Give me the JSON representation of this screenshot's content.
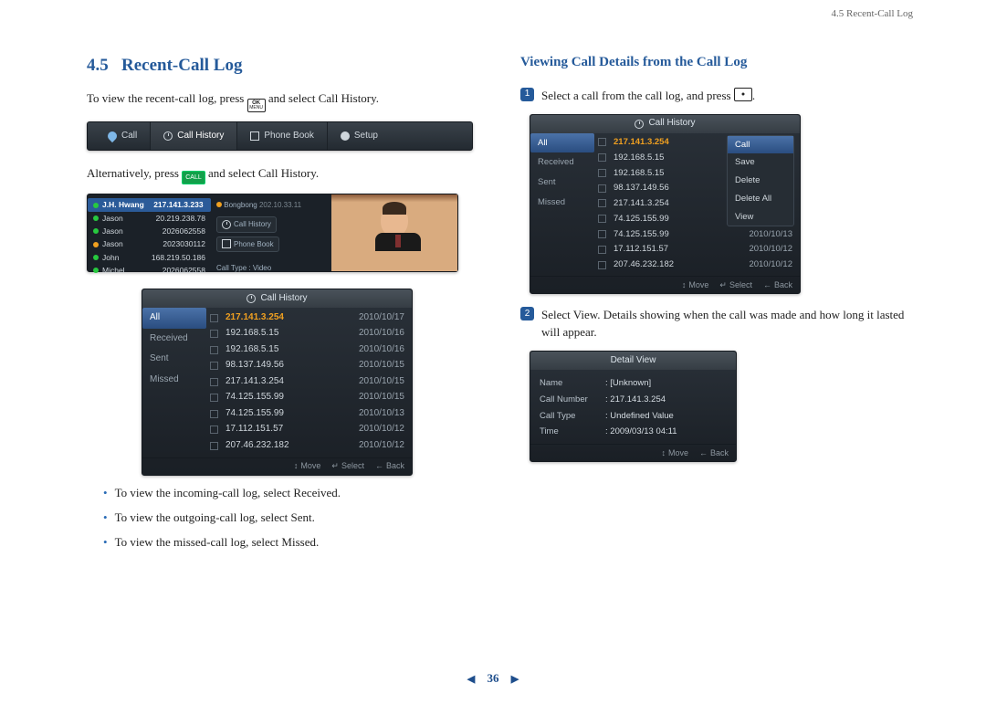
{
  "runhead": "4.5 Recent-Call Log",
  "section_no": "4.5",
  "section_title": "Recent-Call Log",
  "p1_a": "To view the recent-call log, press ",
  "p1_b": " and select Call History.",
  "kbd_ok_top": "OK",
  "kbd_ok_bot": "MENU",
  "p2_a": "Alternatively, press ",
  "p2_b": " and select Call History.",
  "kbd_call": "CALL",
  "nav": {
    "call": "Call",
    "history": "Call History",
    "book": "Phone Book",
    "setup": "Setup"
  },
  "contacts": {
    "sel_name": "J.H. Hwang",
    "sel_ip": "217.141.3.233",
    "rows": [
      {
        "n": "Jason",
        "v": "20.219.238.78"
      },
      {
        "n": "Jason",
        "v": "2026062558"
      },
      {
        "n": "Jason",
        "v": "2023030112"
      },
      {
        "n": "John",
        "v": "168.219.50.186"
      },
      {
        "n": "Michel",
        "v": "2026062558"
      }
    ],
    "bong_name": "Bongbong",
    "bong_ip": "202.10.33.11",
    "pill_history": "Call History",
    "pill_book": "Phone Book",
    "calltype_label": "Call Type : Video"
  },
  "hist_title": "Call History",
  "side": {
    "all": "All",
    "received": "Received",
    "sent": "Sent",
    "missed": "Missed"
  },
  "hist_rows": [
    {
      "ip": "217.141.3.254",
      "d": "2010/10/17"
    },
    {
      "ip": "192.168.5.15",
      "d": "2010/10/16"
    },
    {
      "ip": "192.168.5.15",
      "d": "2010/10/16"
    },
    {
      "ip": "98.137.149.56",
      "d": "2010/10/15"
    },
    {
      "ip": "217.141.3.254",
      "d": "2010/10/15"
    },
    {
      "ip": "74.125.155.99",
      "d": "2010/10/15"
    },
    {
      "ip": "74.125.155.99",
      "d": "2010/10/13"
    },
    {
      "ip": "17.112.151.57",
      "d": "2010/10/12"
    },
    {
      "ip": "207.46.232.182",
      "d": "2010/10/12"
    }
  ],
  "ftr": {
    "move": "Move",
    "select": "Select",
    "back": "Back"
  },
  "bul": [
    "To view the incoming-call log, select Received.",
    "To view the outgoing-call log, select Sent.",
    "To view the missed-call log, select Missed."
  ],
  "right_title": "Viewing Call Details from the Call Log",
  "step1_a": "Select a call from the call log, and press ",
  "step1_b": ".",
  "popup": {
    "call": "Call",
    "save": "Save",
    "delete": "Delete",
    "deleteall": "Delete All",
    "view": "View"
  },
  "step2": "Select View. Details showing when the call was made and how long it lasted will appear.",
  "detail_title": "Detail View",
  "detail": {
    "name_k": "Name",
    "name_v": "[Unknown]",
    "num_k": "Call Number",
    "num_v": "217.141.3.254",
    "type_k": "Call Type",
    "type_v": "Undefined Value",
    "time_k": "Time",
    "time_v": "2009/03/13 04:11"
  },
  "page_no": "36"
}
